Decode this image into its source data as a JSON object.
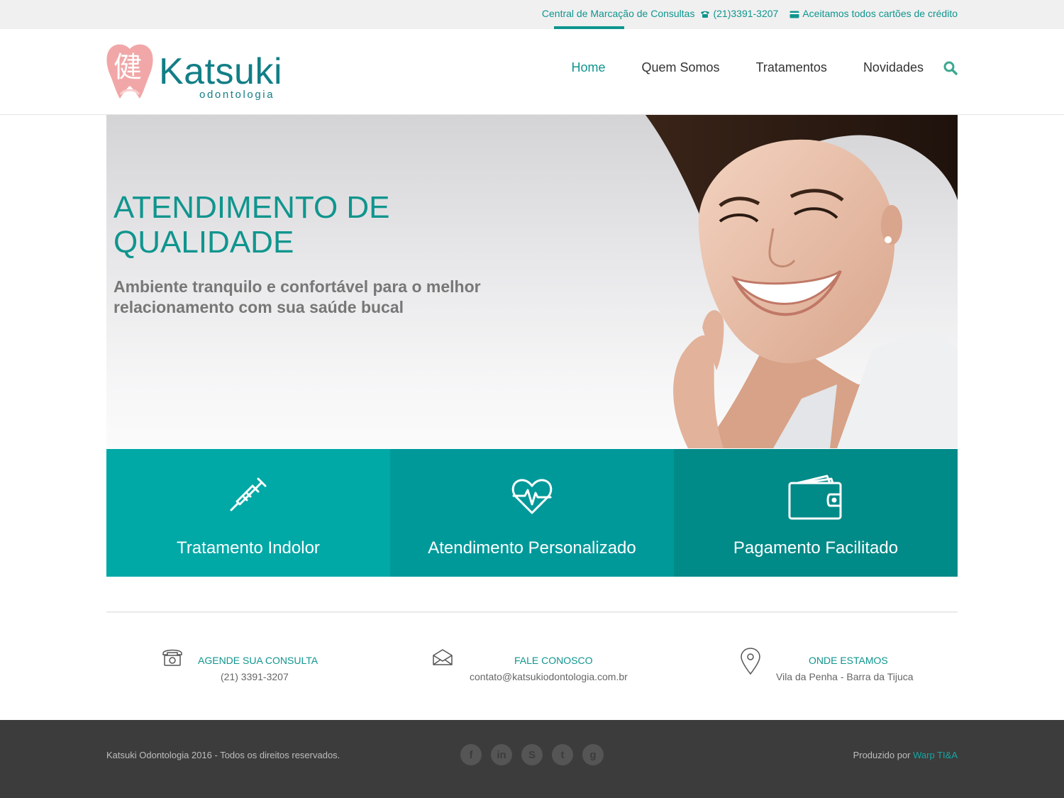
{
  "topbar": {
    "central_label": "Central de Marcação de Consultas",
    "phone": "(21)3391-3207",
    "cards": "Aceitamos todos cartões de crédito"
  },
  "logo": {
    "kanji": "健",
    "brand": "Katsuki",
    "sub": "odontologia"
  },
  "nav": {
    "items": [
      "Home",
      "Quem Somos",
      "Tratamentos",
      "Novidades"
    ],
    "active": "Home"
  },
  "hero": {
    "title": "ATENDIMENTO DE QUALIDADE",
    "subtitle": "Ambiente tranquilo e confortável para o melhor relacionamento com sua saúde bucal"
  },
  "features": [
    {
      "label": "Tratamento Indolor",
      "icon": "syringe-icon",
      "color": "#00a8a6"
    },
    {
      "label": "Atendimento Personalizado",
      "icon": "heartbeat-icon",
      "color": "#00999a"
    },
    {
      "label": "Pagamento Facilitado",
      "icon": "wallet-icon",
      "color": "#008a88"
    }
  ],
  "contact": {
    "phone": {
      "title": "AGENDE SUA CONSULTA",
      "value": "(21) 3391-3207",
      "icon": "telephone-icon"
    },
    "email": {
      "title": "FALE CONOSCO",
      "value": "contato@katsukiodontologia.com.br",
      "icon": "envelope-icon"
    },
    "location": {
      "title": "ONDE ESTAMOS",
      "value": "Vila da Penha  -  Barra da Tijuca",
      "icon": "map-pin-icon"
    }
  },
  "footer": {
    "copyright": "Katsuki Odontologia 2016 - Todos os direitos reservados.",
    "social": [
      {
        "name": "facebook",
        "glyph": "f"
      },
      {
        "name": "linkedin",
        "glyph": "in"
      },
      {
        "name": "skype",
        "glyph": "S"
      },
      {
        "name": "twitter",
        "glyph": "t"
      },
      {
        "name": "google-plus",
        "glyph": "g"
      }
    ],
    "credit_prefix": "Produzido por",
    "credit_link": "Warp TI&A"
  },
  "colors": {
    "accent": "#0f958e",
    "footer_bg": "#3c3c3c",
    "logo_pink": "#f1a7a7"
  }
}
